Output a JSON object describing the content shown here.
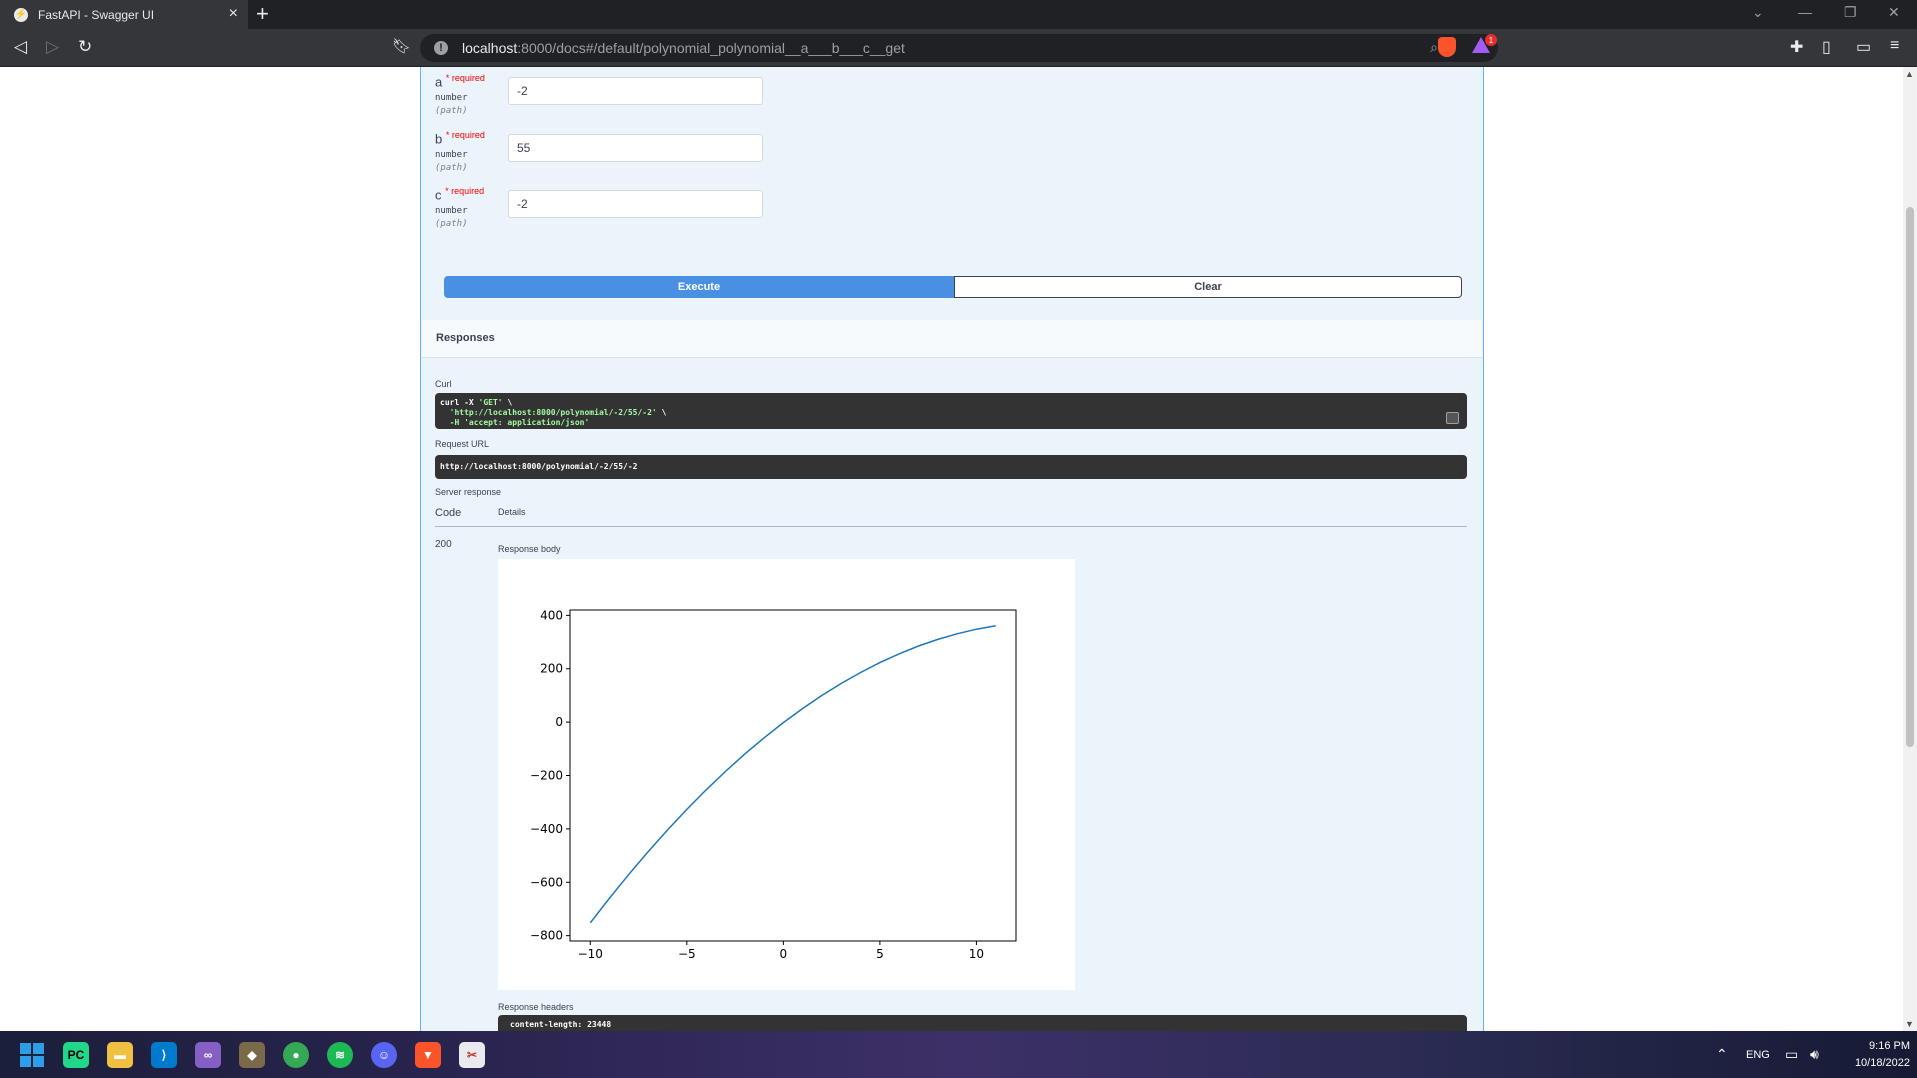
{
  "browser": {
    "tab_title": "FastAPI - Swagger UI",
    "url_host": "localhost",
    "url_rest": ":8000/docs#/default/polynomial_polynomial__a___b___c__get"
  },
  "params": [
    {
      "name": "a",
      "required": "* required",
      "type": "number",
      "in": "(path)",
      "value": "-2"
    },
    {
      "name": "b",
      "required": "* required",
      "type": "number",
      "in": "(path)",
      "value": "55"
    },
    {
      "name": "c",
      "required": "* required",
      "type": "number",
      "in": "(path)",
      "value": "-2"
    }
  ],
  "buttons": {
    "execute": "Execute",
    "clear": "Clear"
  },
  "responses": {
    "title": "Responses",
    "curl_label": "Curl",
    "curl_line1": "curl -X ",
    "curl_method": "'GET'",
    "curl_line1_end": " \\",
    "curl_url": "  'http://localhost:8000/polynomial/-2/55/-2'",
    "curl_line2_end": " \\",
    "curl_header": "  -H 'accept: application/json'",
    "request_url_label": "Request URL",
    "request_url": "http://localhost:8000/polynomial/-2/55/-2",
    "server_response_label": "Server response",
    "col_code": "Code",
    "col_details": "Details",
    "code": "200",
    "body_label": "Response body",
    "headers_label": "Response headers",
    "headers_value": "content-length: 23448"
  },
  "chart_data": {
    "type": "line",
    "title": "",
    "xlabel": "",
    "ylabel": "",
    "xlim": [
      -11.05,
      12.05
    ],
    "ylim": [
      -820,
      420
    ],
    "xticks": [
      -10,
      -5,
      0,
      5,
      10
    ],
    "xtick_labels": [
      "−10",
      "−5",
      "0",
      "5",
      "10"
    ],
    "yticks": [
      400,
      200,
      0,
      -200,
      -400,
      -600,
      -800
    ],
    "ytick_labels": [
      "400",
      "200",
      "0",
      "−200",
      "−400",
      "−600",
      "−800"
    ],
    "grid": false,
    "series": [
      {
        "color": "#1f77b4",
        "x": [
          -10,
          -9,
          -8,
          -7,
          -6,
          -5,
          -4,
          -3,
          -2,
          -1,
          0,
          1,
          2,
          3,
          4,
          5,
          6,
          7,
          8,
          9,
          10,
          11
        ],
        "y": [
          -752,
          -659,
          -570,
          -485,
          -404,
          -327,
          -254,
          -185,
          -120,
          -59,
          -2,
          51,
          100,
          145,
          186,
          223,
          256,
          285,
          310,
          331,
          348,
          361
        ]
      }
    ]
  },
  "taskbar": {
    "lang": "ENG",
    "time": "9:16 PM",
    "date": "10/18/2022"
  },
  "colors": {
    "accent": "#61affe",
    "execute": "#4990e2",
    "line": "#1f77b4"
  }
}
